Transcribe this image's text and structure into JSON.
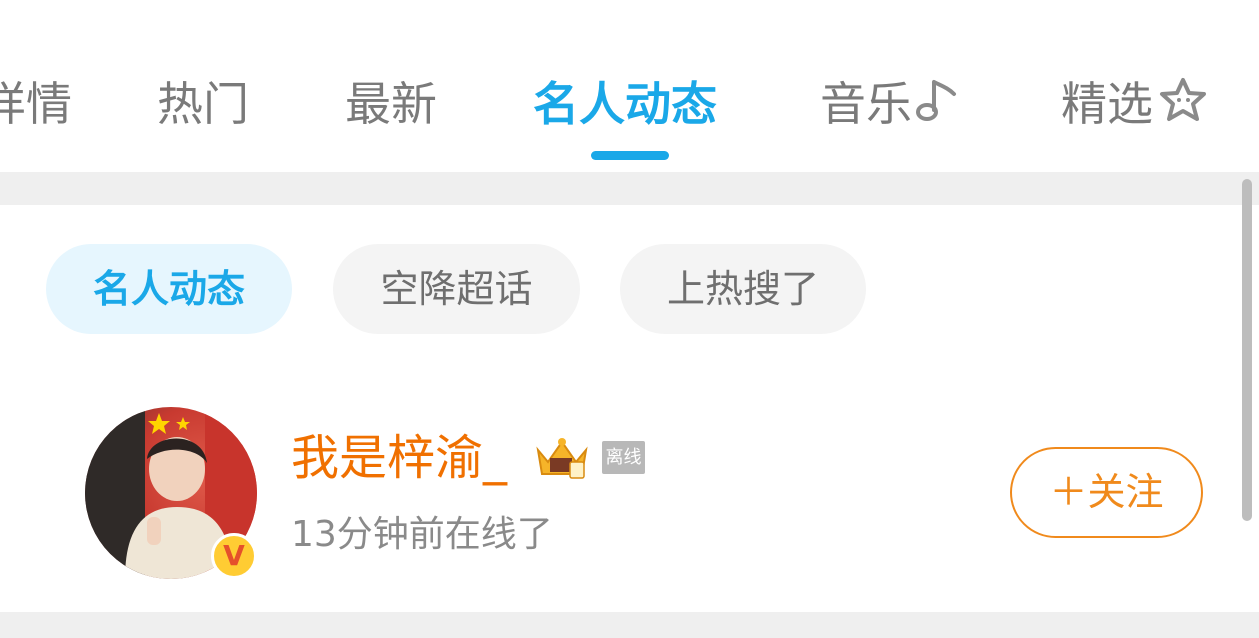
{
  "tabs": [
    {
      "label": "详情",
      "active": false
    },
    {
      "label": "热门",
      "active": false
    },
    {
      "label": "最新",
      "active": false
    },
    {
      "label": "名人动态",
      "active": true
    },
    {
      "label": "音乐",
      "icon": "music-note-icon",
      "active": false
    },
    {
      "label": "精选",
      "icon": "star-icon",
      "active": false
    }
  ],
  "chips": [
    {
      "label": "名人动态",
      "active": true
    },
    {
      "label": "空降超话",
      "active": false
    },
    {
      "label": "上热搜了",
      "active": false
    }
  ],
  "user": {
    "name": "我是梓渝_",
    "offline_label": "离线",
    "status": "13分钟前在线了",
    "verified_badge": "V",
    "follow_label": "＋关注"
  },
  "colors": {
    "accent": "#1aa8e8",
    "username": "#f07000",
    "follow": "#f08a1c",
    "inactive_tab": "#7a7a7a"
  }
}
